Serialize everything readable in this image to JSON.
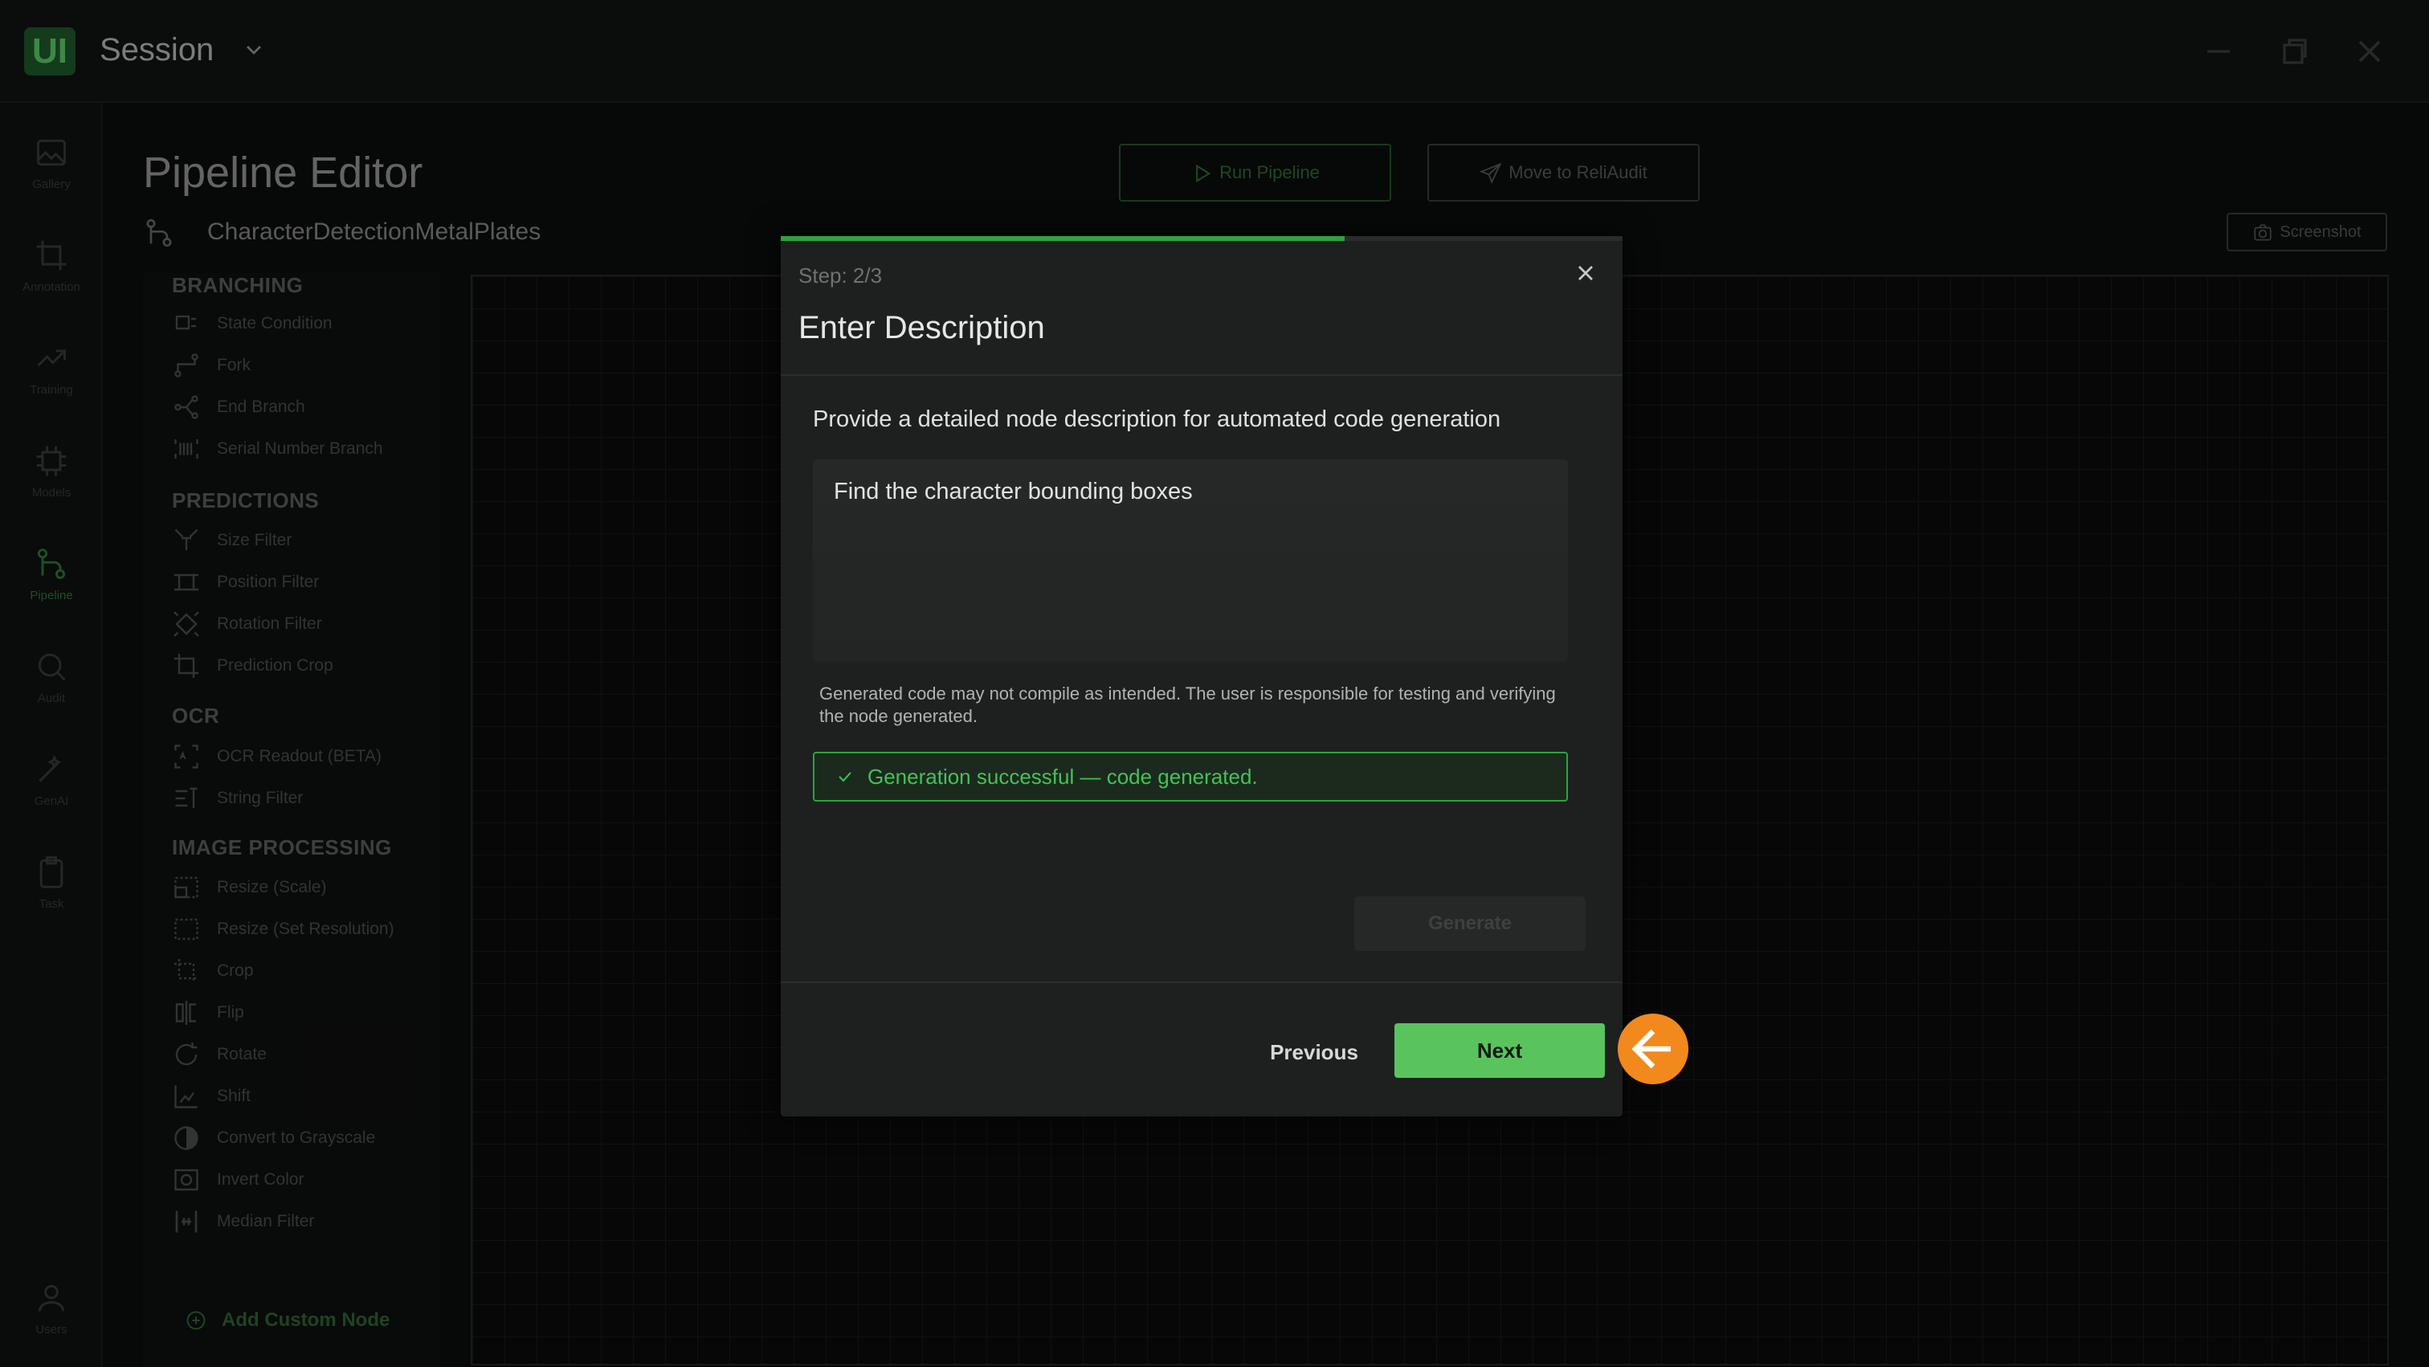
{
  "titlebar": {
    "logo": "UI",
    "session": "Session"
  },
  "rail": [
    {
      "label": "Gallery",
      "icon": "image-icon"
    },
    {
      "label": "Annotation",
      "icon": "crop-icon"
    },
    {
      "label": "Training",
      "icon": "trend-icon"
    },
    {
      "label": "Models",
      "icon": "chip-icon"
    },
    {
      "label": "Pipeline",
      "icon": "pipeline-icon"
    },
    {
      "label": "Audit",
      "icon": "search-icon"
    },
    {
      "label": "GenAI",
      "icon": "wand-icon"
    },
    {
      "label": "Task",
      "icon": "clipboard-icon"
    },
    {
      "label": "Users",
      "icon": "user-icon"
    }
  ],
  "header": {
    "title": "Pipeline Editor",
    "pipeline_name": "CharacterDetectionMetalPlates",
    "run_label": "Run Pipeline",
    "move_label": "Move to ReliAudit",
    "screenshot_label": "Screenshot"
  },
  "palette": {
    "sections": [
      {
        "title": "BRANCHING",
        "items": [
          "State Condition",
          "Fork",
          "End Branch",
          "Serial Number Branch"
        ]
      },
      {
        "title": "PREDICTIONS",
        "items": [
          "Size Filter",
          "Position Filter",
          "Rotation Filter",
          "Prediction Crop"
        ]
      },
      {
        "title": "OCR",
        "items": [
          "OCR Readout (BETA)",
          "String Filter"
        ]
      },
      {
        "title": "IMAGE PROCESSING",
        "items": [
          "Resize (Scale)",
          "Resize (Set Resolution)",
          "Crop",
          "Flip",
          "Rotate",
          "Shift",
          "Convert to Grayscale",
          "Invert Color",
          "Median Filter"
        ]
      }
    ],
    "add_custom": "Add Custom Node"
  },
  "modal": {
    "step": "Step: 2/3",
    "progress": 0.67,
    "title": "Enter Description",
    "prompt": "Provide a detailed node description for automated code generation",
    "description_value": "Find the character bounding boxes",
    "disclaimer": "Generated code may not compile as intended. The user is responsible for testing and verifying the node generated.",
    "success": "Generation successful — code generated.",
    "generate_label": "Generate",
    "previous_label": "Previous",
    "next_label": "Next"
  },
  "colors": {
    "accent": "#59c45d",
    "success": "#2fa33f",
    "pointer": "#f2891d"
  }
}
